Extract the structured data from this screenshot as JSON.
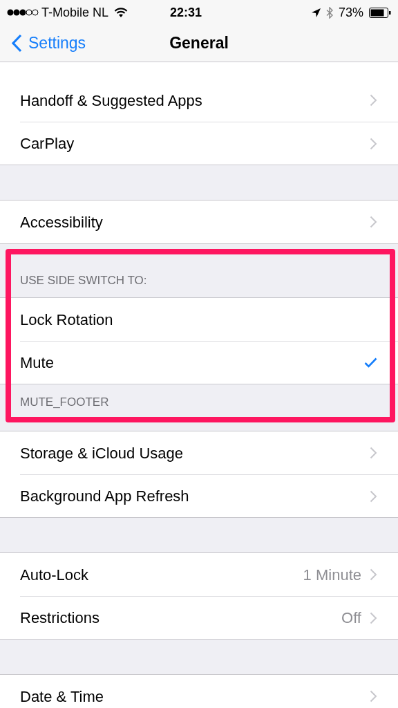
{
  "status_bar": {
    "carrier": "T-Mobile NL",
    "time": "22:31",
    "battery": "73%"
  },
  "nav": {
    "back": "Settings",
    "title": "General"
  },
  "sections": [
    {
      "rows": [
        {
          "kind": "nav",
          "label": "Handoff & Suggested Apps"
        },
        {
          "kind": "nav",
          "label": "CarPlay"
        }
      ]
    },
    {
      "rows": [
        {
          "kind": "nav",
          "label": "Accessibility"
        }
      ]
    },
    {
      "highlighted": true,
      "header": "USE SIDE SWITCH TO:",
      "footer": "MUTE_FOOTER",
      "rows": [
        {
          "kind": "check",
          "label": "Lock Rotation",
          "selected": false
        },
        {
          "kind": "check",
          "label": "Mute",
          "selected": true
        }
      ]
    },
    {
      "rows": [
        {
          "kind": "nav",
          "label": "Storage & iCloud Usage"
        },
        {
          "kind": "nav",
          "label": "Background App Refresh"
        }
      ]
    },
    {
      "rows": [
        {
          "kind": "nav",
          "label": "Auto-Lock",
          "value": "1 Minute"
        },
        {
          "kind": "nav",
          "label": "Restrictions",
          "value": "Off"
        }
      ]
    },
    {
      "rows": [
        {
          "kind": "nav",
          "label": "Date & Time"
        }
      ]
    }
  ]
}
